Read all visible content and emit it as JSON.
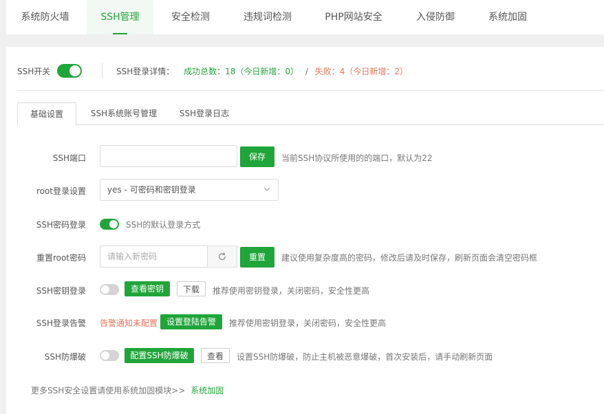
{
  "nav": {
    "tabs": [
      {
        "label": "系统防火墙"
      },
      {
        "label": "SSH管理"
      },
      {
        "label": "安全检测"
      },
      {
        "label": "违规词检测"
      },
      {
        "label": "PHP网站安全"
      },
      {
        "label": "入侵防御"
      },
      {
        "label": "系统加固"
      }
    ],
    "active_index": 1
  },
  "status": {
    "ssh_switch_label": "SSH开关",
    "ssh_switch_on": true,
    "detail_label": "SSH登录详情：",
    "success_text": "成功总数：18（今日新增：0）",
    "separator": "/",
    "fail_text": "失败：4（今日新增：2）"
  },
  "subtabs": [
    {
      "label": "基础设置"
    },
    {
      "label": "SSH系统账号管理"
    },
    {
      "label": "SSH登录日志"
    }
  ],
  "form": {
    "port": {
      "label": "SSH端口",
      "value": "",
      "save_label": "保存",
      "hint": "当前SSH协议所使用的的端口，默认为22"
    },
    "root_login": {
      "label": "root登录设置",
      "selected": "yes - 可密码和密钥登录"
    },
    "password_login": {
      "label": "SSH密码登录",
      "enabled": true,
      "hint": "SSH的默认登录方式"
    },
    "reset_root": {
      "label": "重置root密码",
      "placeholder": "请输入新密码",
      "reset_label": "重置",
      "hint": "建议使用复杂度高的密码，修改后请及时保存，刷新页面会清空密码框"
    },
    "key_login": {
      "label": "SSH密钥登录",
      "enabled": false,
      "view_key_label": "查看密钥",
      "download_label": "下载",
      "hint": "推荐使用密钥登录，关闭密码，安全性更高"
    },
    "login_alert": {
      "label": "SSH登录告警",
      "status_text": "告警通知未配置",
      "setup_label": "设置登陆告警",
      "hint": "推荐使用密钥登录，关闭密码，安全性更高"
    },
    "anti_brute": {
      "label": "SSH防爆破",
      "enabled": false,
      "config_label": "配置SSH防爆破",
      "view_label": "查看",
      "hint": "设置SSH防爆破，防止主机被恶意爆破，首次安装后，请手动刷新页面"
    }
  },
  "footer": {
    "text": "更多SSH安全设置请使用系统加固模块>>",
    "link_label": "系统加固"
  },
  "colors": {
    "accent": "#20a53a",
    "warn": "#e6735a"
  }
}
